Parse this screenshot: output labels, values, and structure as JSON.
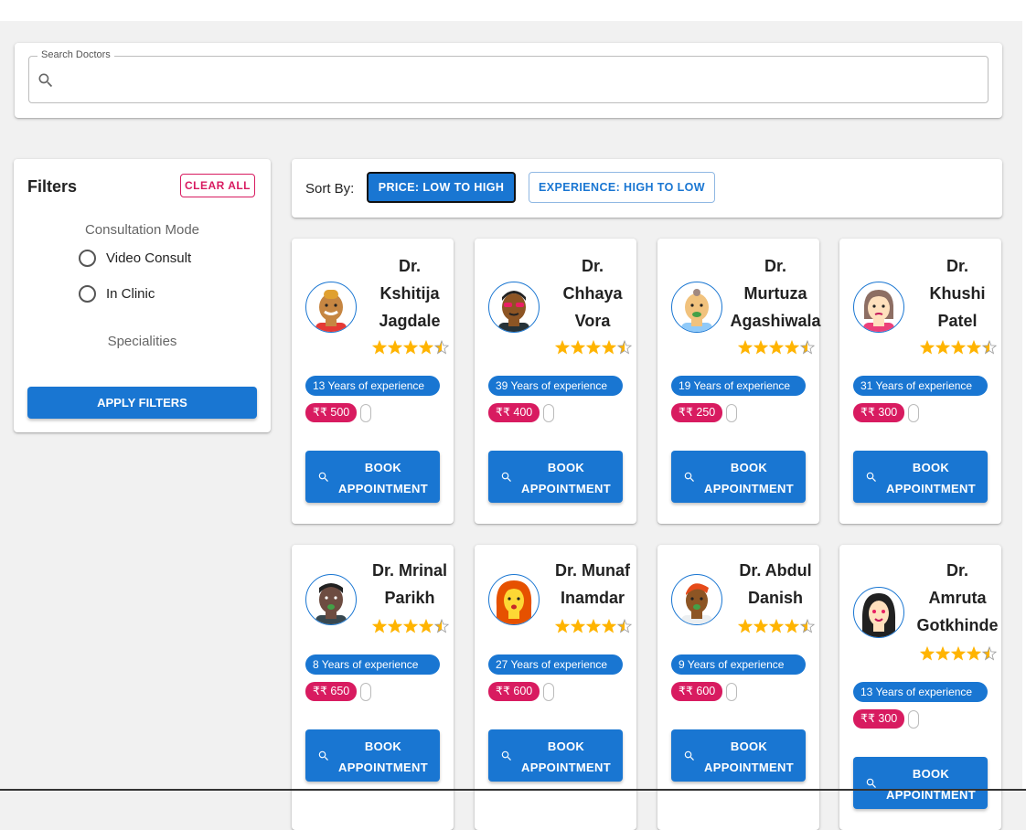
{
  "search": {
    "legend": "Search Doctors",
    "value": "",
    "placeholder": ""
  },
  "filters": {
    "title": "Filters",
    "clear_label": "CLEAR ALL",
    "mode_title": "Consultation Mode",
    "modes": [
      "Video Consult",
      "In Clinic"
    ],
    "specialities_title": "Specialities",
    "apply_label": "APPLY FILTERS"
  },
  "sort": {
    "label": "Sort By:",
    "options": [
      {
        "label": "PRICE: LOW TO HIGH",
        "active": true
      },
      {
        "label": "EXPERIENCE: HIGH TO LOW",
        "active": false
      }
    ]
  },
  "colors": {
    "primary": "#1976d2",
    "accent": "#d81b60",
    "star": "#ffb400"
  },
  "book_label": "BOOK\nAPPOINTMENT",
  "doctors": [
    {
      "name": "Dr.\nKshitija\nJagdale",
      "experience": "13 Years of experience",
      "fee": "₹₹ 500",
      "rating": 4.5,
      "avatar": "avatar-man-mohawk"
    },
    {
      "name": "Dr.\nChhaya\nVora",
      "experience": "39 Years of experience",
      "fee": "₹₹ 400",
      "rating": 4.5,
      "avatar": "avatar-man-sunglasses"
    },
    {
      "name": "Dr.\nMurtuza\nAgashiwala",
      "experience": "19 Years of experience",
      "fee": "₹₹ 250",
      "rating": 4.5,
      "avatar": "avatar-man-bald"
    },
    {
      "name": "Dr.\nKhushi\nPatel",
      "experience": "31 Years of experience",
      "fee": "₹₹ 300",
      "rating": 4.5,
      "avatar": "avatar-woman-brown-hair"
    },
    {
      "name": "Dr. Mrinal\nParikh",
      "experience": "8 Years of experience",
      "fee": "₹₹ 650",
      "rating": 4.5,
      "avatar": "avatar-man-dark"
    },
    {
      "name": "Dr. Munaf\nInamdar",
      "experience": "27 Years of experience",
      "fee": "₹₹ 600",
      "rating": 4.5,
      "avatar": "avatar-woman-red-hair"
    },
    {
      "name": "Dr. Abdul\nDanish",
      "experience": "9 Years of experience",
      "fee": "₹₹ 600",
      "rating": 4.5,
      "avatar": "avatar-man-red-hair"
    },
    {
      "name": "Dr.\nAmruta\nGotkhinde",
      "experience": "13 Years of experience",
      "fee": "₹₹ 300",
      "rating": 4.5,
      "avatar": "avatar-woman-black-hair"
    }
  ]
}
